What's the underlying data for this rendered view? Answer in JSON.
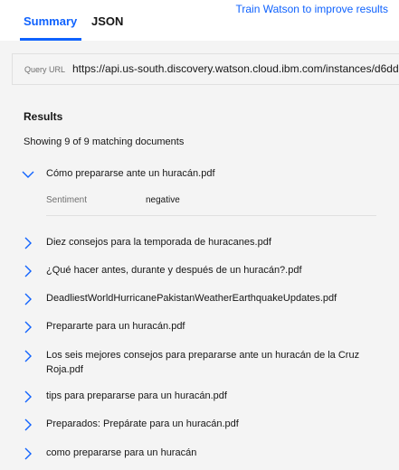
{
  "header": {
    "train_link": "Train Watson to improve results",
    "tabs": [
      "Summary",
      "JSON"
    ]
  },
  "query": {
    "label": "Query URL",
    "url": "https://api.us-south.discovery.watson.cloud.ibm.com/instances/d6dd"
  },
  "results": {
    "title": "Results",
    "count_text": "Showing 9 of 9 matching documents",
    "documents": [
      "Cómo prepararse ante un huracán.pdf",
      "Diez consejos para la temporada de huracanes.pdf",
      "¿Qué hacer antes, durante y después de un huracán?.pdf",
      "DeadliestWorldHurricanePakistanWeatherEarthquakeUpdates.pdf",
      "Prepararte para un huracán.pdf",
      "Los seis mejores consejos para prepararse ante un huracán de la Cruz Roja.pdf",
      "tips para prepararse para un huracán.pdf",
      "Preparados: Prepárate para un huracán.pdf",
      "como prepararse para un huracán"
    ],
    "expanded_detail": {
      "label": "Sentiment",
      "value": "negative"
    }
  },
  "colors": {
    "accent": "#0f62fe",
    "background": "#f4f4f4"
  },
  "icons": {
    "collapsed": "chevron-right-icon",
    "expanded": "chevron-down-icon"
  }
}
